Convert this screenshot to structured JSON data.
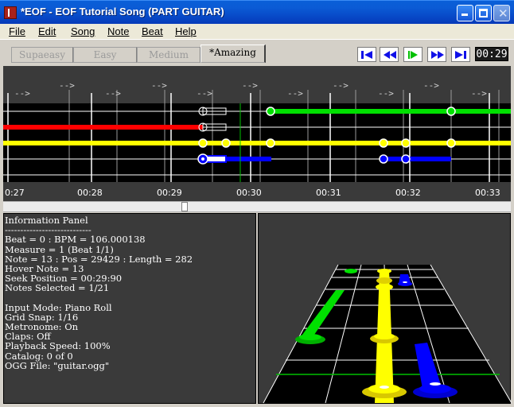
{
  "window": {
    "title": "*EOF - EOF Tutorial Song (PART GUITAR)"
  },
  "menu": {
    "items": [
      "File",
      "Edit",
      "Song",
      "Note",
      "Beat",
      "Help"
    ]
  },
  "difficulty_tabs": [
    {
      "label": "Supaeasy",
      "active": false
    },
    {
      "label": "Easy",
      "active": false
    },
    {
      "label": "Medium",
      "active": false
    },
    {
      "label": "*Amazing",
      "active": true
    }
  ],
  "transport": {
    "buttons": [
      "skip-to-start-icon",
      "rewind-icon",
      "play-icon",
      "fast-forward-icon",
      "skip-to-end-icon"
    ],
    "time": "00:29",
    "colors": {
      "blue": "#1010e8",
      "green": "#00c000"
    }
  },
  "timeline": {
    "beat_markers": [
      "-->",
      "-->",
      "-->",
      "-->",
      "-->",
      "-->",
      "-->",
      "-->",
      "-->",
      "-->",
      "-->"
    ],
    "time_labels": [
      "0:27",
      "00:28",
      "00:29",
      "00:30",
      "00:31",
      "00:32",
      "00:33"
    ]
  },
  "lane_colors": {
    "green": "#00e000",
    "red": "#ff0000",
    "yellow": "#ffff00",
    "blue": "#0000ff"
  },
  "info_panel": {
    "lines": [
      "Information Panel",
      "----------------------------",
      "Beat = 0 : BPM = 106.000138",
      "Measure = 1 (Beat 1/1)",
      "Note = 13 : Pos = 29429 : Length = 282",
      "Hover Note = 13",
      "Seek Position = 00:29:90",
      "Notes Selected = 1/21",
      "",
      "Input Mode: Piano Roll",
      "Grid Snap: 1/16",
      "Metronome: On",
      "Claps: Off",
      "Playback Speed: 100%",
      "Catalog: 0 of 0",
      "OGG File: \"guitar.ogg\""
    ]
  }
}
